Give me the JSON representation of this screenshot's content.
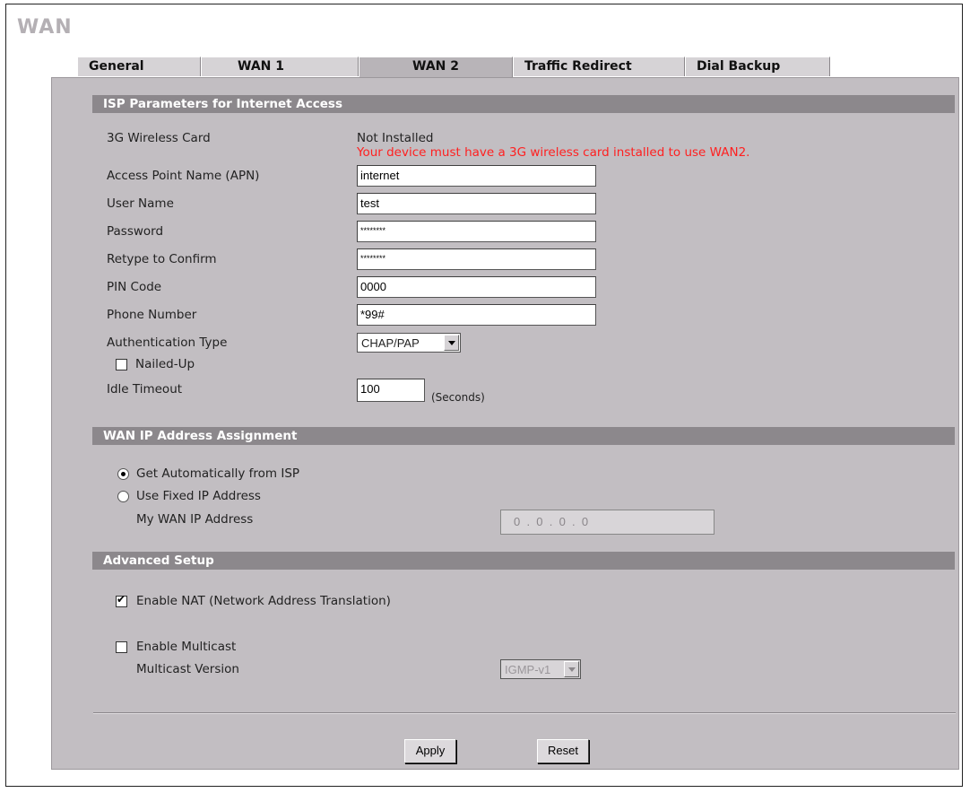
{
  "page": {
    "title": "WAN"
  },
  "tabs": [
    {
      "label": "General"
    },
    {
      "label": "WAN 1"
    },
    {
      "label": "WAN 2",
      "active": true
    },
    {
      "label": "Traffic Redirect"
    },
    {
      "label": "Dial Backup"
    }
  ],
  "isp": {
    "section_title": "ISP Parameters for Internet Access",
    "wireless_card_label": "3G Wireless Card",
    "wireless_card_status": "Not Installed",
    "wireless_card_warning": "Your device must have a 3G wireless card installed to use WAN2.",
    "apn_label": "Access Point Name (APN)",
    "apn_value": "internet",
    "username_label": "User Name",
    "username_value": "test",
    "password_label": "Password",
    "password_value": "********",
    "retype_label": "Retype to Confirm",
    "retype_value": "********",
    "pin_label": "PIN Code",
    "pin_value": "0000",
    "phone_label": "Phone Number",
    "phone_value": "*99#",
    "auth_label": "Authentication Type",
    "auth_value": "CHAP/PAP",
    "nailed_label": "Nailed-Up",
    "nailed_checked": false,
    "idle_label": "Idle Timeout",
    "idle_value": "100",
    "idle_unit": "(Seconds)"
  },
  "wanip": {
    "section_title": "WAN IP Address Assignment",
    "auto_label": "Get Automatically from ISP",
    "fixed_label": "Use Fixed IP Address",
    "my_ip_label": "My WAN IP Address",
    "my_ip_value": "0  .  0  .  0  .  0"
  },
  "advanced": {
    "section_title": "Advanced Setup",
    "nat_label": "Enable NAT (Network Address Translation)",
    "nat_checked": true,
    "multicast_label": "Enable Multicast",
    "multicast_checked": false,
    "multicast_version_label": "Multicast Version",
    "multicast_version_value": "IGMP-v1"
  },
  "actions": {
    "apply_label": "Apply",
    "reset_label": "Reset"
  }
}
